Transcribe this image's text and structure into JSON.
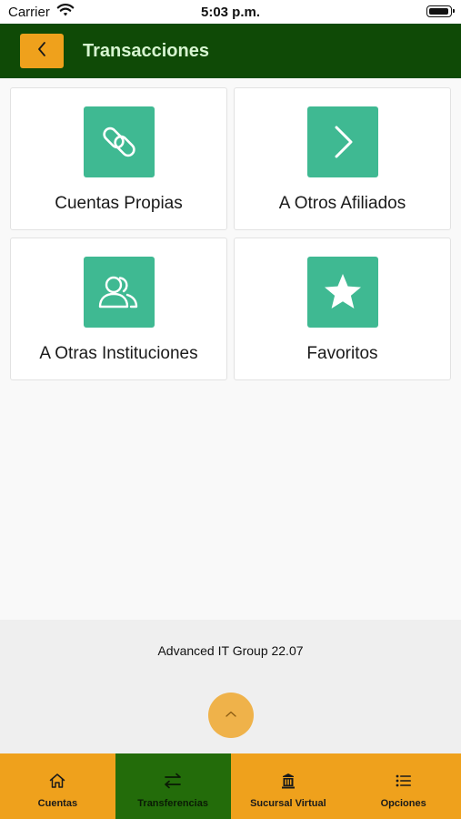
{
  "status_bar": {
    "carrier": "Carrier",
    "time": "5:03 p.m."
  },
  "header": {
    "title": "Transacciones",
    "back_icon": "chevron-left-icon"
  },
  "tiles": [
    {
      "label": "Cuentas Propias",
      "icon": "link-icon"
    },
    {
      "label": "A Otros Afiliados",
      "icon": "chevron-right-icon"
    },
    {
      "label": "A Otras Instituciones",
      "icon": "users-icon"
    },
    {
      "label": "Favoritos",
      "icon": "star-icon"
    }
  ],
  "footer": {
    "text": "Advanced IT Group 22.07",
    "scroll_icon": "chevron-up-icon"
  },
  "tabs": [
    {
      "label": "Cuentas",
      "icon": "home-icon",
      "active": false
    },
    {
      "label": "Transferencias",
      "icon": "transfer-icon",
      "active": true
    },
    {
      "label": "Sucursal Virtual",
      "icon": "bank-icon",
      "active": false
    },
    {
      "label": "Opciones",
      "icon": "list-icon",
      "active": false
    }
  ],
  "colors": {
    "header_bg": "#0f4a06",
    "accent_orange": "#efa11c",
    "tile_icon_green": "#3fb992",
    "active_tab_green": "#236c0a"
  }
}
